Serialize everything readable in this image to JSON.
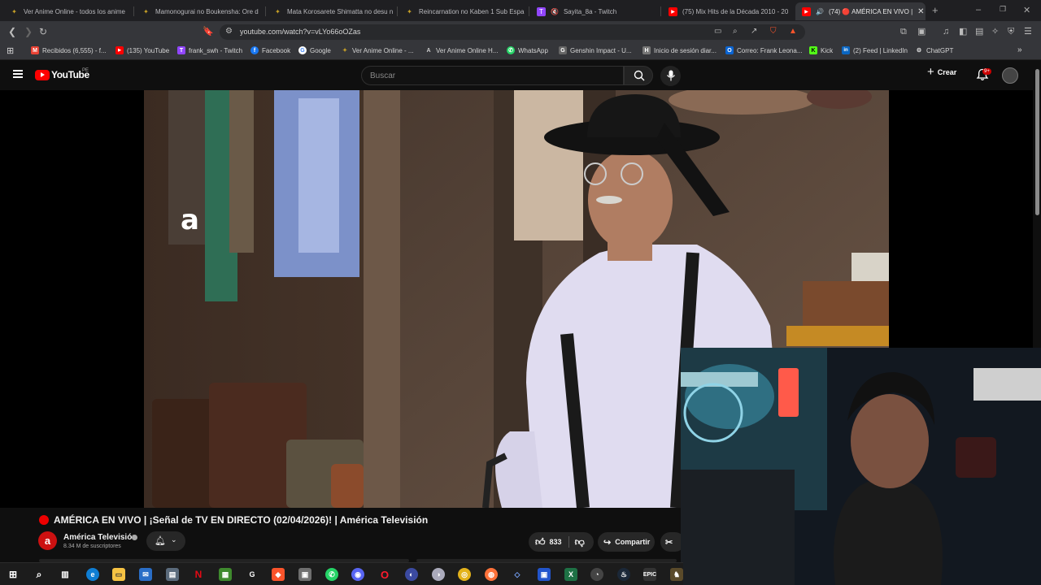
{
  "browser": {
    "tabs": [
      {
        "label": "Ver Anime Online - todos los anime",
        "icon": "anime-site-icon",
        "color": "#c9a227"
      },
      {
        "label": "Mamonogurai no Boukensha: Ore d",
        "icon": "anime-site-icon",
        "color": "#c9a227"
      },
      {
        "label": "Mata Korosarete Shimatta no desu n",
        "icon": "anime-site-icon",
        "color": "#c9a227"
      },
      {
        "label": "Reincarnation no Kaben 1 Sub Espa",
        "icon": "anime-site-icon",
        "color": "#c9a227"
      },
      {
        "label": "Sayita_8a - Twitch",
        "icon": "twitch-icon",
        "color": "#9146ff"
      },
      {
        "label": "(75) Mix Hits de la Década 2010 - 20",
        "icon": "youtube-icon",
        "color": "#ff0000"
      },
      {
        "label": "(74) 🔴 AMÉRICA EN VIVO |",
        "icon": "youtube-icon",
        "color": "#ff0000",
        "active": true
      }
    ],
    "url": "youtube.com/watch?v=vLYo66oOZas",
    "bookmarks": [
      {
        "label": "Recibidos (6,555) - f...",
        "icon": "gmail-icon",
        "color": "#ea4335",
        "glyph": "M"
      },
      {
        "label": "(135) YouTube",
        "icon": "youtube-icon",
        "color": "#ff0000",
        "glyph": "▶"
      },
      {
        "label": "frank_swh - Twitch",
        "icon": "twitch-icon",
        "color": "#9146ff",
        "glyph": "T"
      },
      {
        "label": "Facebook",
        "icon": "facebook-icon",
        "color": "#1877f2",
        "glyph": "f"
      },
      {
        "label": "Google",
        "icon": "google-icon",
        "color": "#4285f4",
        "glyph": "G"
      },
      {
        "label": "Ver Anime Online - ...",
        "icon": "anime-site-icon",
        "color": "#c9a227",
        "glyph": "✦"
      },
      {
        "label": "Ver Anime Online H...",
        "icon": "anime-site-icon",
        "color": "#555555",
        "glyph": "A"
      },
      {
        "label": "WhatsApp",
        "icon": "whatsapp-icon",
        "color": "#25d366",
        "glyph": "✆"
      },
      {
        "label": "Genshin Impact - U...",
        "icon": "genshin-icon",
        "color": "#666666",
        "glyph": "G"
      },
      {
        "label": "Inicio de sesión diar...",
        "icon": "hoyolab-icon",
        "color": "#777777",
        "glyph": "H"
      },
      {
        "label": "Correo: Frank Leona...",
        "icon": "outlook-icon",
        "color": "#0a64d2",
        "glyph": "O"
      },
      {
        "label": "Kick",
        "icon": "kick-icon",
        "color": "#53fc18",
        "glyph": "K"
      },
      {
        "label": "(2) Feed | LinkedIn",
        "icon": "linkedin-icon",
        "color": "#0a66c2",
        "glyph": "in"
      },
      {
        "label": "ChatGPT",
        "icon": "chatgpt-icon",
        "color": "#555555",
        "glyph": "⚙"
      }
    ]
  },
  "youtube": {
    "logo_text": "YouTube",
    "country": "PE",
    "search_placeholder": "Buscar",
    "create_label": "Crear",
    "notification_badge": "9+",
    "video": {
      "title": "AMÉRICA EN VIVO | ¡Señal de TV EN DIRECTO (02/04/2026)! | América Televisión",
      "channel_name": "América Televisión",
      "channel_initial": "a",
      "subscribers": "8.34 M de suscriptores",
      "likes": "833",
      "share_label": "Compartir",
      "bug_glyph": "a"
    }
  },
  "colors": {
    "live": "#ee0000",
    "brand_red": "#ff0000",
    "channel_red": "#cc1111"
  }
}
